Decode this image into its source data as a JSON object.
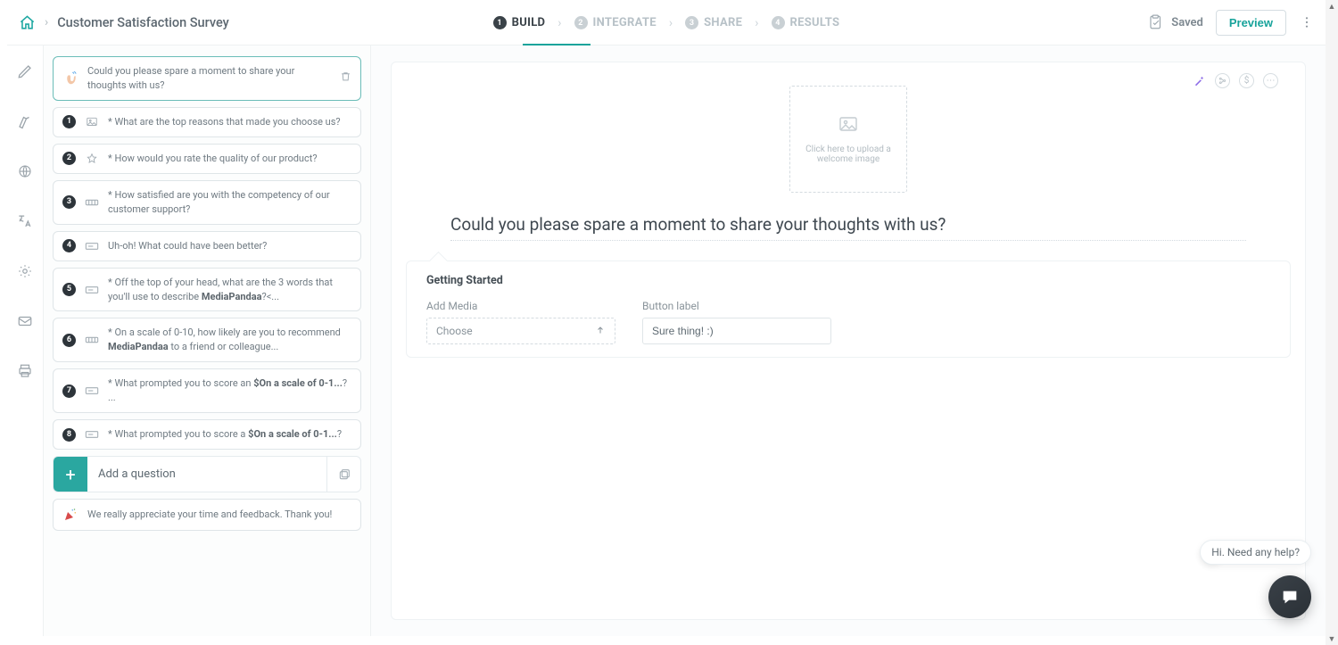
{
  "header": {
    "title": "Customer Satisfaction Survey",
    "saved_label": "Saved",
    "preview_label": "Preview"
  },
  "tabs": [
    {
      "num": "1",
      "label": "BUILD",
      "active": true
    },
    {
      "num": "2",
      "label": "INTEGRATE",
      "active": false
    },
    {
      "num": "3",
      "label": "SHARE",
      "active": false
    },
    {
      "num": "4",
      "label": "RESULTS",
      "active": false
    }
  ],
  "welcome_card": {
    "text": "Could you please spare a moment to share your thoughts with us?"
  },
  "questions": [
    {
      "num": "1",
      "icon": "picture-icon",
      "req": true,
      "text": "What are the top reasons that made you choose us?"
    },
    {
      "num": "2",
      "icon": "star-icon",
      "req": true,
      "text": "How would you rate the quality of our product?"
    },
    {
      "num": "3",
      "icon": "scale-icon",
      "req": true,
      "text": "How satisfied are you with the competency of our customer support?"
    },
    {
      "num": "4",
      "icon": "text-icon",
      "req": false,
      "text": "Uh-oh! What could have been better?"
    },
    {
      "num": "5",
      "icon": "text-icon",
      "req": true,
      "text_pre": "Off the top of your head, what are the 3 words that you'll use to describe ",
      "bold": "MediaPandaa",
      "text_post": "?<..."
    },
    {
      "num": "6",
      "icon": "scale-icon",
      "req": true,
      "text_pre": "On a scale of 0-10, how likely are you to recommend ",
      "bold": "MediaPandaa",
      "text_post": " to a friend or colleague..."
    },
    {
      "num": "7",
      "icon": "text-icon",
      "req": true,
      "text_pre": "What prompted you to score an ",
      "bold": "$On a scale of 0-1...",
      "text_post": "?"
    },
    {
      "num": "8",
      "icon": "text-icon",
      "req": true,
      "text_pre": "What prompted you to score a ",
      "bold": "$On a scale of 0-1...",
      "text_post": "?"
    }
  ],
  "add_question": {
    "label": "Add a question"
  },
  "thankyou_card": {
    "text": "We really appreciate your time and feedback. Thank you!"
  },
  "canvas": {
    "upload_text": "Click here to upload a welcome image",
    "welcome_question": "Could you please spare a moment to share your thoughts with us?",
    "section_title": "Getting Started",
    "add_media_label": "Add Media",
    "choose_label": "Choose",
    "button_label_label": "Button label",
    "button_label_value": "Sure thing! :)"
  },
  "help": {
    "text": "Hi. Need any help?"
  },
  "float_actions": {
    "dollar": "$",
    "dots": "⋯"
  }
}
